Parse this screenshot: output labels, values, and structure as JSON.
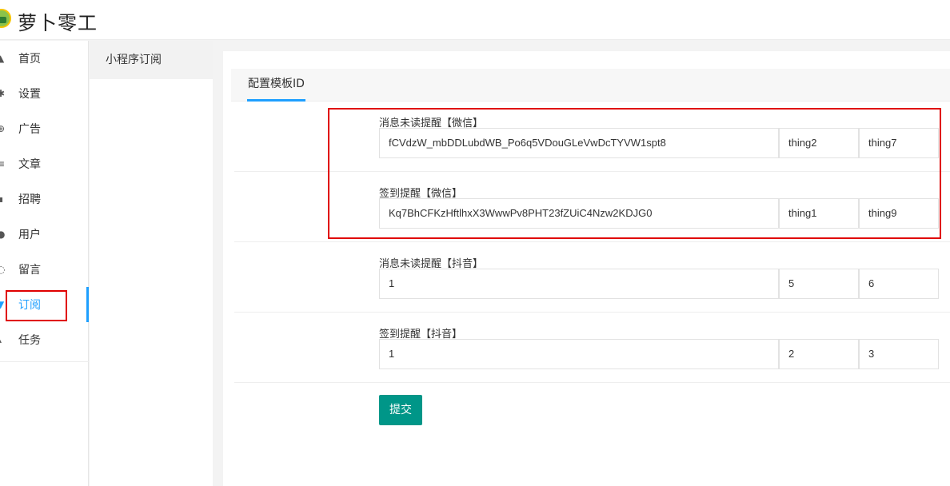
{
  "header": {
    "app_title": "萝卜零工"
  },
  "sidebar": {
    "items": [
      {
        "label": "首页",
        "icon": "home-icon",
        "glyph": "▲"
      },
      {
        "label": "设置",
        "icon": "gear-icon",
        "glyph": "✱"
      },
      {
        "label": "广告",
        "icon": "globe-icon",
        "glyph": "⊕"
      },
      {
        "label": "文章",
        "icon": "document-icon",
        "glyph": "≡"
      },
      {
        "label": "招聘",
        "icon": "briefcase-icon",
        "glyph": "▪"
      },
      {
        "label": "用户",
        "icon": "user-icon",
        "glyph": "●"
      },
      {
        "label": "留言",
        "icon": "message-icon",
        "glyph": "◌"
      },
      {
        "label": "订阅",
        "icon": "subscribe-icon",
        "glyph": "▼",
        "active": true
      },
      {
        "label": "任务",
        "icon": "task-icon",
        "glyph": "▴"
      }
    ]
  },
  "subsidebar": {
    "items": [
      {
        "label": "小程序订阅"
      }
    ]
  },
  "tabs": [
    {
      "label": "配置模板ID"
    }
  ],
  "form": {
    "rows": [
      {
        "label": "消息未读提醒【微信】",
        "template_id": "fCVdzW_mbDDLubdWB_Po6q5VDouGLeVwDcTYVW1spt8",
        "key1": "thing2",
        "key2": "thing7"
      },
      {
        "label": "签到提醒【微信】",
        "template_id": "Kq7BhCFKzHftlhxX3WwwPv8PHT23fZUiC4Nzw2KDJG0",
        "key1": "thing1",
        "key2": "thing9"
      },
      {
        "label": "消息未读提醒【抖音】",
        "template_id": "1",
        "key1": "5",
        "key2": "6"
      },
      {
        "label": "签到提醒【抖音】",
        "template_id": "1",
        "key1": "2",
        "key2": "3"
      }
    ],
    "submit_label": "提交"
  },
  "colors": {
    "accent": "#1e9fff",
    "submit": "#009688",
    "highlight": "#e00000"
  }
}
